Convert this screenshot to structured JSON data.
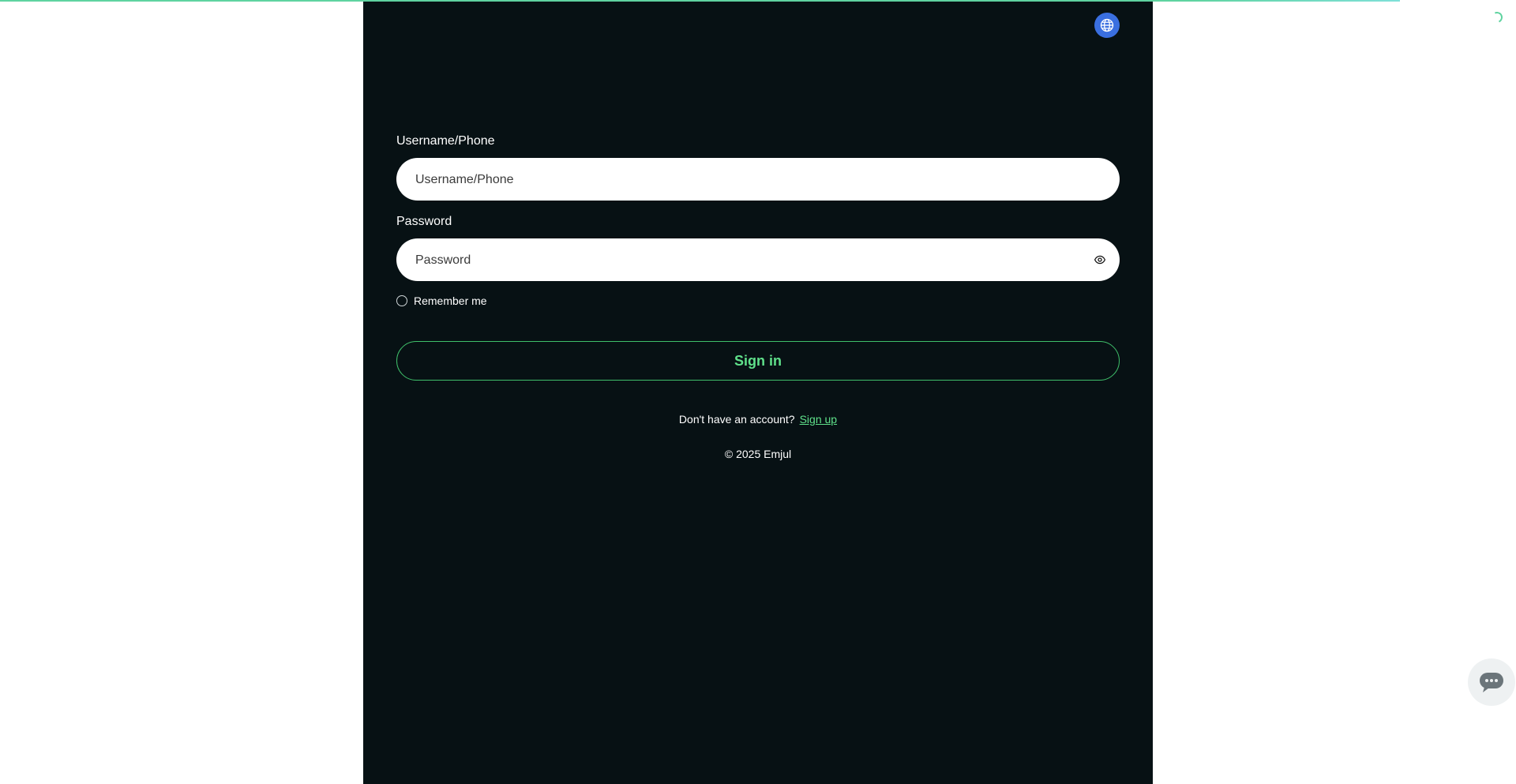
{
  "top_progress": {
    "color": "#5fd3a0"
  },
  "language_button": {
    "icon": "globe-icon",
    "color": "#3a6fe0"
  },
  "login": {
    "username_label": "Username/Phone",
    "username_placeholder": "Username/Phone",
    "username_value": "",
    "password_label": "Password",
    "password_placeholder": "Password",
    "password_value": "",
    "show_password_icon": "eye-icon",
    "remember_label": "Remember me",
    "remember_checked": false,
    "signin_label": "Sign in",
    "no_account_text": "Don't have an account?",
    "signup_link": "Sign up",
    "copyright": "© 2025 Emjul"
  },
  "chat_widget": {
    "icon": "chat-icon"
  },
  "colors": {
    "panel_bg": "#071114",
    "accent": "#5fe08a",
    "page_bg": "#ffffff"
  }
}
